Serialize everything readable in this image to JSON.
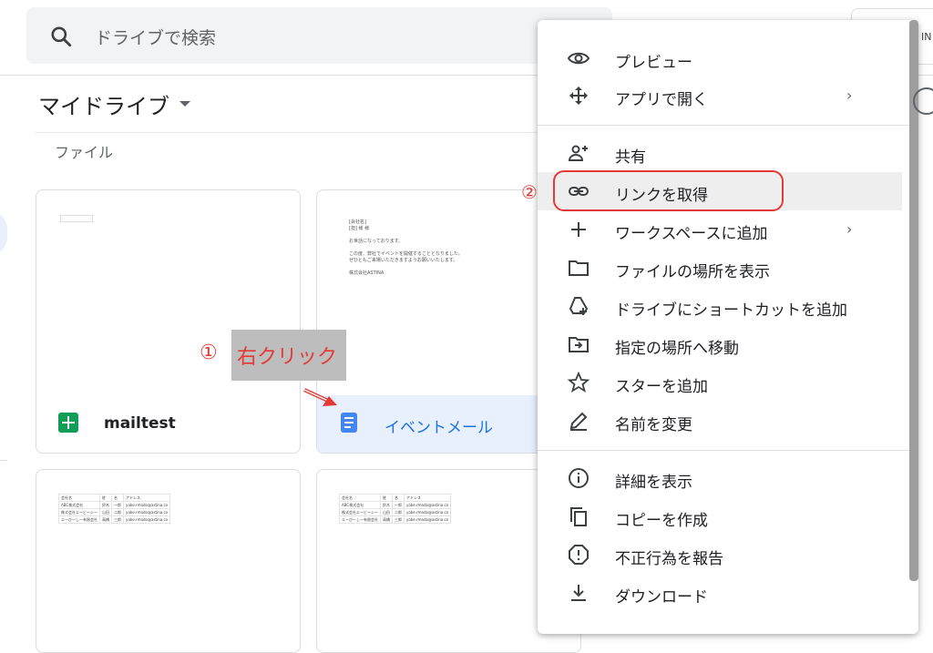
{
  "search": {
    "placeholder": "ドライブで検索"
  },
  "header": {
    "right_button_label": "IN"
  },
  "drive": {
    "title": "マイドライブ",
    "section_label": "ファイル"
  },
  "files": [
    {
      "name": "mailtest",
      "type": "spreadsheet",
      "icon": "sheets-icon"
    },
    {
      "name": "イベントメール",
      "type": "document",
      "icon": "docs-icon",
      "preview_lines": [
        "[会社名]",
        "[担] 様 様",
        "",
        "お世話になっております。",
        "",
        "この度、弊社でイベントを開催することとなりました。",
        "ぜひともご来場いただきますようお願いいたします。",
        "",
        "株式会社ASTINA"
      ]
    }
  ],
  "sheet_preview": {
    "headers": [
      "会社名",
      "姓",
      "名",
      "アドレス"
    ],
    "rows": [
      [
        "ABC株式会社",
        "鈴木",
        "一郎",
        "yabe.rmado@astina.co"
      ],
      [
        "株式会社エービーシー",
        "山田",
        "二郎",
        "yabe.rmado@astina.co"
      ],
      [
        "エーびーしー有限会社",
        "高橋",
        "三郎",
        "yabe.rmado@astina.co"
      ]
    ]
  },
  "annotations": {
    "step1_number": "①",
    "step1_text": "右クリック",
    "step2_number": "②",
    "color": "#e53935"
  },
  "context_menu": {
    "groups": [
      [
        {
          "label": "プレビュー",
          "icon": "eye-icon",
          "submenu": false
        },
        {
          "label": "アプリで開く",
          "icon": "move-arrows-icon",
          "submenu": true
        }
      ],
      [
        {
          "label": "共有",
          "icon": "person-add-icon",
          "submenu": false
        },
        {
          "label": "リンクを取得",
          "icon": "link-icon",
          "submenu": false,
          "highlighted": true
        },
        {
          "label": "ワークスペースに追加",
          "icon": "plus-icon",
          "submenu": true
        },
        {
          "label": "ファイルの場所を表示",
          "icon": "folder-icon",
          "submenu": false
        },
        {
          "label": "ドライブにショートカットを追加",
          "icon": "drive-shortcut-icon",
          "submenu": false
        },
        {
          "label": "指定の場所へ移動",
          "icon": "move-to-folder-icon",
          "submenu": false
        },
        {
          "label": "スターを追加",
          "icon": "star-icon",
          "submenu": false
        },
        {
          "label": "名前を変更",
          "icon": "pencil-icon",
          "submenu": false
        }
      ],
      [
        {
          "label": "詳細を表示",
          "icon": "info-icon",
          "submenu": false
        },
        {
          "label": "コピーを作成",
          "icon": "copy-icon",
          "submenu": false
        },
        {
          "label": "不正行為を報告",
          "icon": "report-icon",
          "submenu": false
        },
        {
          "label": "ダウンロード",
          "icon": "download-icon",
          "submenu": false
        }
      ]
    ],
    "chevron": "›"
  },
  "colors": {
    "accent": "#1a73e8",
    "sheets": "#0f9d58",
    "docs": "#4285f4",
    "selected_card": "#e8f0fe"
  }
}
